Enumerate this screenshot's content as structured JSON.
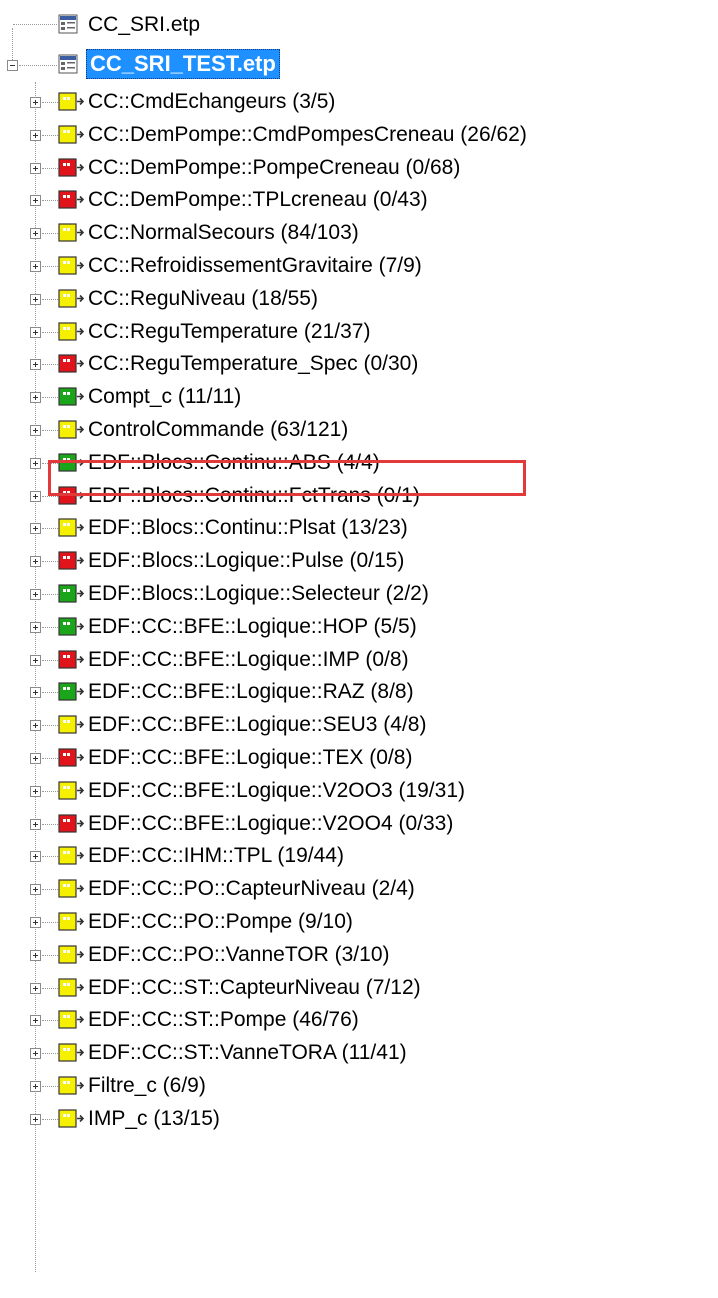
{
  "tree": {
    "files": [
      {
        "label": "CC_SRI.etp",
        "selected": false
      },
      {
        "label": "CC_SRI_TEST.etp",
        "selected": true
      }
    ],
    "items": [
      {
        "label": "CC::CmdEchangeurs (3/5)",
        "status": "yellow"
      },
      {
        "label": "CC::DemPompe::CmdPompesCreneau (26/62)",
        "status": "yellow"
      },
      {
        "label": "CC::DemPompe::PompeCreneau (0/68)",
        "status": "red"
      },
      {
        "label": "CC::DemPompe::TPLcreneau (0/43)",
        "status": "red"
      },
      {
        "label": "CC::NormalSecours (84/103)",
        "status": "yellow"
      },
      {
        "label": "CC::RefroidissementGravitaire (7/9)",
        "status": "yellow"
      },
      {
        "label": "CC::ReguNiveau (18/55)",
        "status": "yellow"
      },
      {
        "label": "CC::ReguTemperature (21/37)",
        "status": "yellow"
      },
      {
        "label": "CC::ReguTemperature_Spec (0/30)",
        "status": "red"
      },
      {
        "label": "Compt_c (11/11)",
        "status": "green"
      },
      {
        "label": "ControlCommande (63/121)",
        "status": "yellow",
        "highlighted": true
      },
      {
        "label": "EDF::Blocs::Continu::ABS (4/4)",
        "status": "green"
      },
      {
        "label": "EDF::Blocs::Continu::FctTrans (0/1)",
        "status": "red"
      },
      {
        "label": "EDF::Blocs::Continu::Plsat (13/23)",
        "status": "yellow"
      },
      {
        "label": "EDF::Blocs::Logique::Pulse (0/15)",
        "status": "red"
      },
      {
        "label": "EDF::Blocs::Logique::Selecteur (2/2)",
        "status": "green"
      },
      {
        "label": "EDF::CC::BFE::Logique::HOP (5/5)",
        "status": "green"
      },
      {
        "label": "EDF::CC::BFE::Logique::IMP (0/8)",
        "status": "red"
      },
      {
        "label": "EDF::CC::BFE::Logique::RAZ (8/8)",
        "status": "green"
      },
      {
        "label": "EDF::CC::BFE::Logique::SEU3 (4/8)",
        "status": "yellow"
      },
      {
        "label": "EDF::CC::BFE::Logique::TEX (0/8)",
        "status": "red"
      },
      {
        "label": "EDF::CC::BFE::Logique::V2OO3 (19/31)",
        "status": "yellow"
      },
      {
        "label": "EDF::CC::BFE::Logique::V2OO4 (0/33)",
        "status": "red"
      },
      {
        "label": "EDF::CC::IHM::TPL (19/44)",
        "status": "yellow"
      },
      {
        "label": "EDF::CC::PO::CapteurNiveau (2/4)",
        "status": "yellow"
      },
      {
        "label": "EDF::CC::PO::Pompe (9/10)",
        "status": "yellow"
      },
      {
        "label": "EDF::CC::PO::VanneTOR (3/10)",
        "status": "yellow"
      },
      {
        "label": "EDF::CC::ST::CapteurNiveau (7/12)",
        "status": "yellow"
      },
      {
        "label": "EDF::CC::ST::Pompe (46/76)",
        "status": "yellow"
      },
      {
        "label": "EDF::CC::ST::VanneTORA (11/41)",
        "status": "yellow"
      },
      {
        "label": "Filtre_c (6/9)",
        "status": "yellow"
      },
      {
        "label": "IMP_c (13/15)",
        "status": "yellow"
      }
    ]
  },
  "colors": {
    "yellow": "#f5f000",
    "red": "#e0141a",
    "green": "#1aa51a",
    "selection": "#1e90ff",
    "highlight_border": "#e23a3a"
  },
  "icons": {
    "file": "project-file-icon",
    "class": "class-status-icon",
    "expander_plus": "expand-plus-icon",
    "expander_minus": "collapse-minus-icon"
  }
}
